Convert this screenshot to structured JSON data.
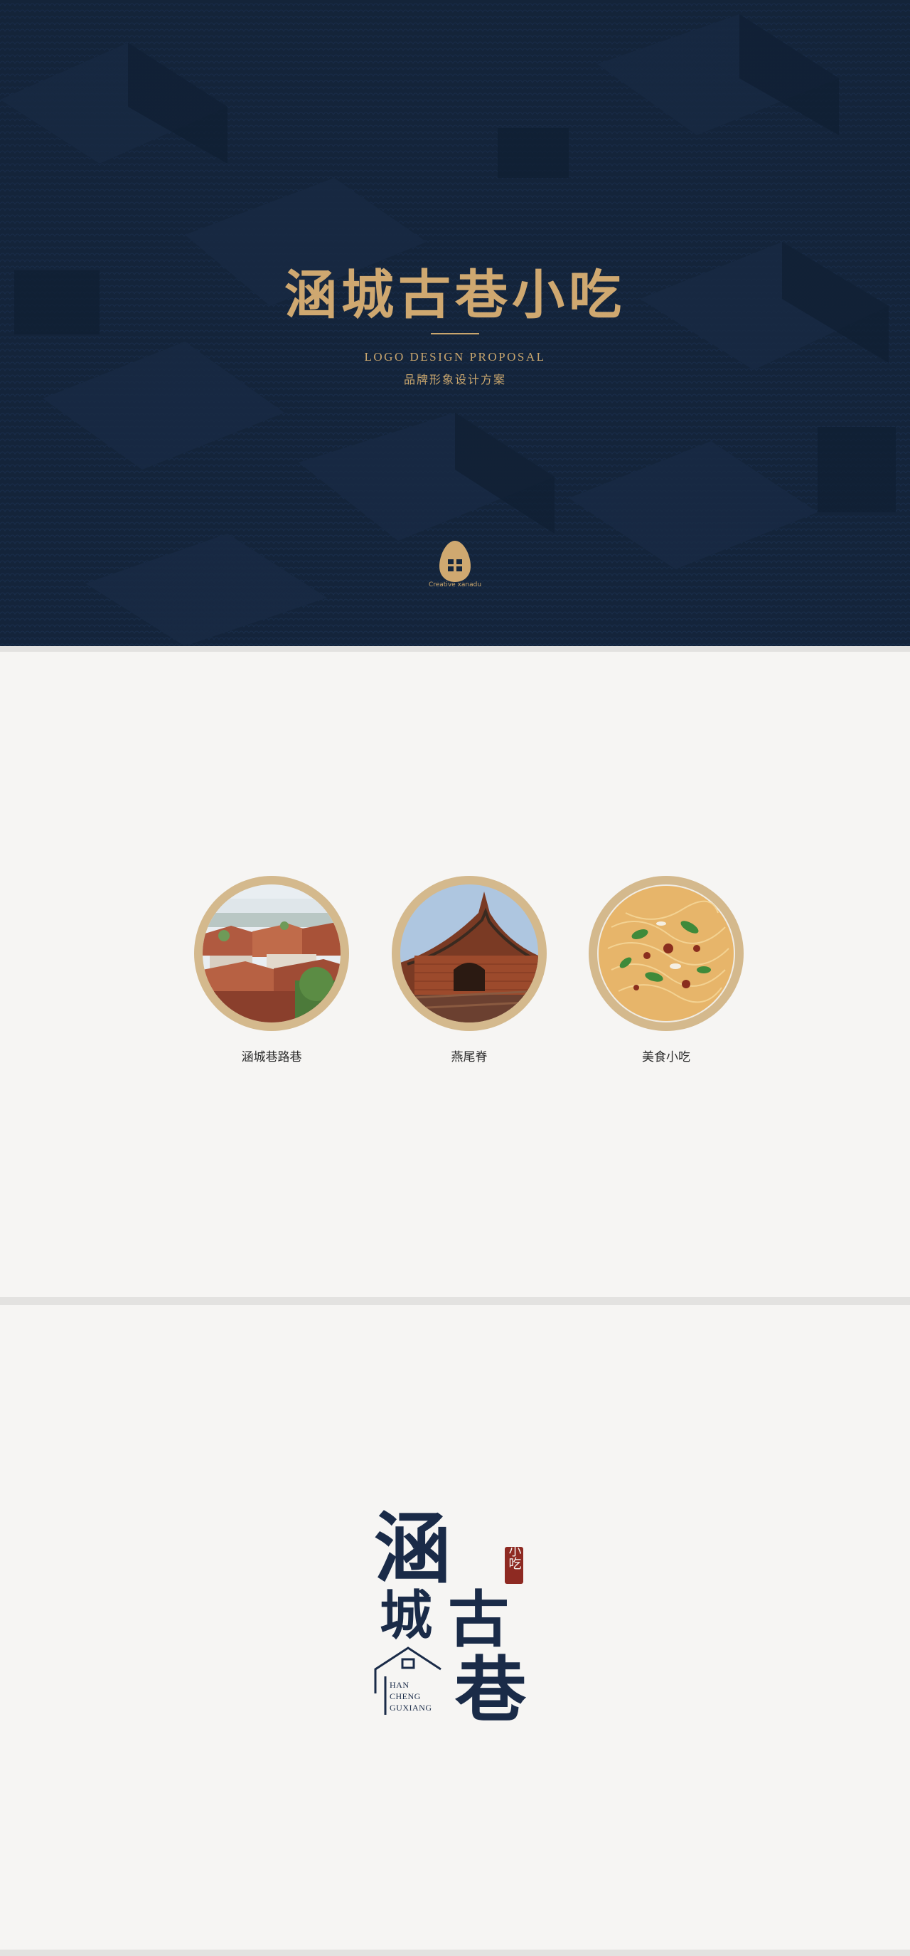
{
  "hero": {
    "title": "涵城古巷小吃",
    "subtitle_en": "LOGO DESIGN PROPOSAL",
    "subtitle_cn": "品牌形象设计方案",
    "brand_caption": "Creative xanadu",
    "brand_mark_icon": "gold-egg-logo-icon",
    "colors": {
      "background": "#15263d",
      "gold": "#cfa870"
    }
  },
  "gallery": {
    "items": [
      {
        "label": "涵城巷路巷",
        "icon": "old-town-rooftops-photo"
      },
      {
        "label": "燕尾脊",
        "icon": "swallowtail-roof-ridge-photo"
      },
      {
        "label": "美食小吃",
        "icon": "noodle-dish-photo"
      }
    ],
    "ring_color": "#d4b98d"
  },
  "logo": {
    "chars": [
      "涵",
      "城",
      "古",
      "巷"
    ],
    "seal_text": "小吃",
    "latin_lines": [
      "HAN",
      "CHENG",
      "GUXIANG"
    ],
    "colors": {
      "ink": "#1a2b48",
      "seal": "#8e2a22"
    }
  }
}
